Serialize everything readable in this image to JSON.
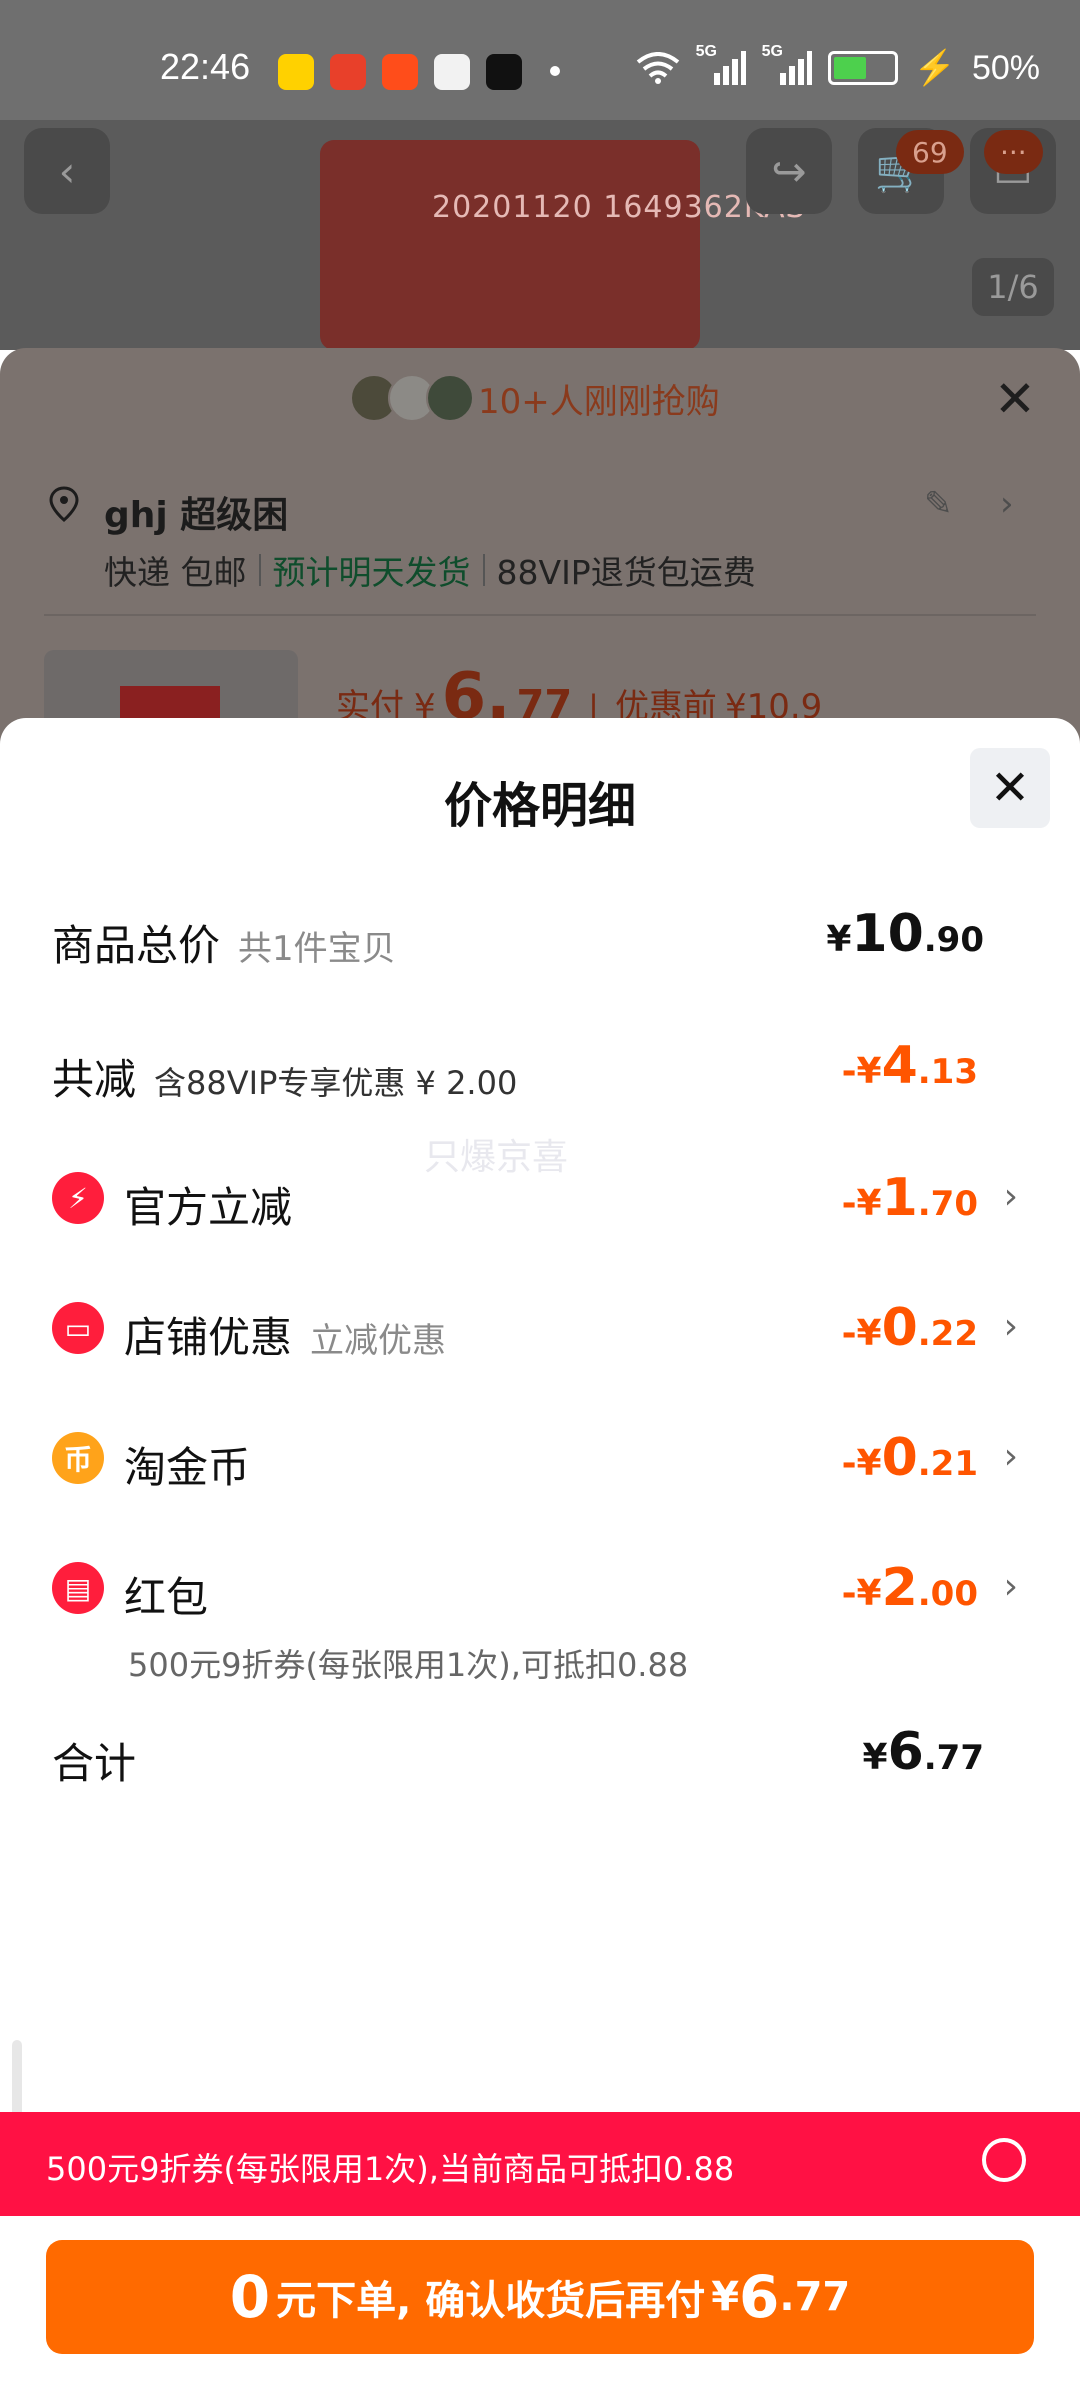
{
  "status_bar": {
    "time": "22:46",
    "signal_labels": [
      "5G",
      "5G"
    ],
    "battery_text": "50%"
  },
  "background": {
    "cap_text": "20201120 1649362KAS",
    "cart_count": "69",
    "more_badge": "···",
    "image_pager": "1/6",
    "buyers_text": "10+人刚刚抢购",
    "address_name": "ghj 超级困",
    "shipping_method": "快递 包邮",
    "shipping_eta": "预计明天发货",
    "shipping_vip": "88VIP退货包运费",
    "pay_label": "实付",
    "pay_currency": "¥",
    "pay_int": "6.",
    "pay_dec": "77",
    "before_label": "优惠前",
    "before_price": "¥10.9"
  },
  "sheet": {
    "title": "价格明细",
    "watermark": "只爆京喜",
    "total": {
      "label": "商品总价",
      "sub": "共1件宝贝",
      "cur": "¥",
      "int": "10",
      "dec": ".90"
    },
    "reduce": {
      "label": "共减",
      "sub": "含88VIP专享优惠 ¥ 2.00",
      "cur": "-¥",
      "int": "4",
      "dec": ".13"
    },
    "items": [
      {
        "label": "官方立减",
        "sub": "",
        "cur": "-¥",
        "int": "1",
        "dec": ".70",
        "icon": "lightning-icon",
        "color": "#ff1e3c"
      },
      {
        "label": "店铺优惠",
        "sub": "立减优惠",
        "cur": "-¥",
        "int": "0",
        "dec": ".22",
        "icon": "shop-icon",
        "color": "#ff1e3c"
      },
      {
        "label": "淘金币",
        "sub": "",
        "cur": "-¥",
        "int": "0",
        "dec": ".21",
        "icon": "coin-icon",
        "color": "#ffa31a"
      },
      {
        "label": "红包",
        "sub": "",
        "cur": "-¥",
        "int": "2",
        "dec": ".00",
        "icon": "red-packet-icon",
        "color": "#ff1e3c"
      }
    ],
    "coupon_note": "500元9折券(每张限用1次),可抵扣0.88",
    "sum": {
      "label": "合计",
      "cur": "¥",
      "int": "6",
      "dec": ".77"
    }
  },
  "coupon_bar": {
    "text": "500元9折券(每张限用1次),当前商品可抵扣0.88"
  },
  "order_button": {
    "big": "0",
    "text": "元下单, 确认收货后再付",
    "cur": "¥",
    "int": "6",
    "dec": ".77"
  },
  "colors": {
    "orange": "#ff5500",
    "button": "#ff6a00",
    "coupon_bar": "#ff1144",
    "green": "#1a8a4a"
  }
}
